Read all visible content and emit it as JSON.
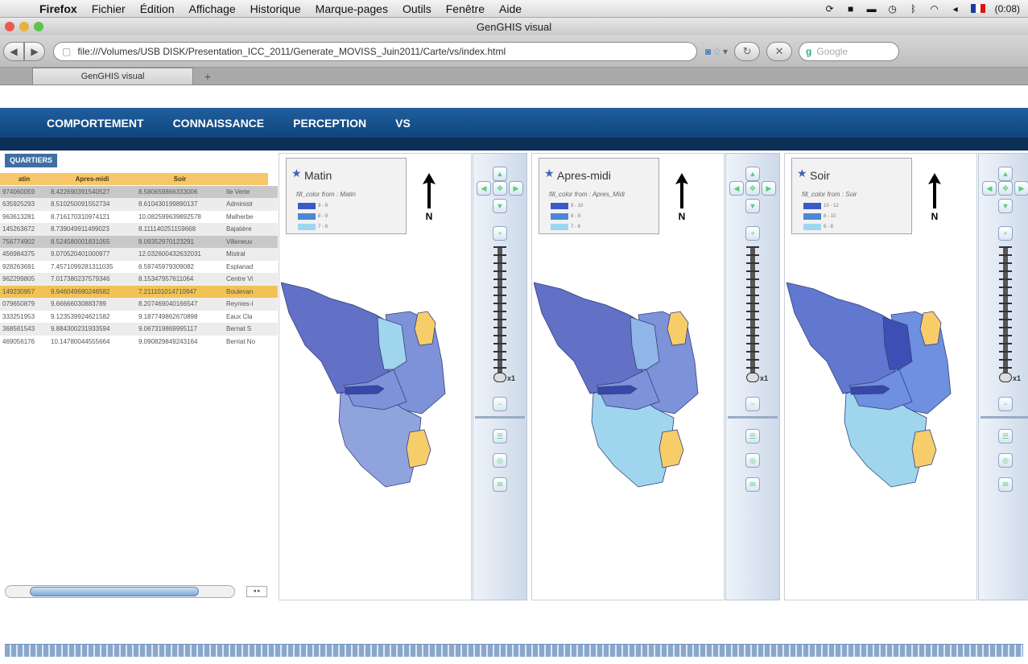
{
  "menubar": {
    "app": "Firefox",
    "items": [
      "Fichier",
      "Édition",
      "Affichage",
      "Historique",
      "Marque-pages",
      "Outils",
      "Fenêtre",
      "Aide"
    ],
    "clock": "(0:08)"
  },
  "window": {
    "title": "GenGHIS visual"
  },
  "toolbar": {
    "url": "file:///Volumes/USB DISK/Presentation_ICC_2011/Generate_MOVISS_Juin2011/Carte/vs/index.html",
    "search_placeholder": "Google"
  },
  "tabs": [
    {
      "label": "GenGHIS visual"
    }
  ],
  "new_tab": "+",
  "app_nav": [
    "COMPORTEMENT",
    "CONNAISSANCE",
    "PERCEPTION",
    "VS"
  ],
  "quartiers": {
    "tab": "QUARTIERS",
    "headers": [
      "atin",
      "Apres-midi",
      "Soir",
      ""
    ],
    "rows": [
      [
        "974060059",
        "8.42269039154052​7",
        "8.5806598663330​06",
        "Ile Verte"
      ],
      [
        "635925293",
        "8.510250091552734",
        "8.610430199890137",
        "Administr"
      ],
      [
        "963613281",
        "8.716170310974121",
        "10.082599639892578",
        "Malherbe"
      ],
      [
        "145263672",
        "8.739049911499023",
        "8.11114025115966​8",
        "Bajatière"
      ],
      [
        "756774902",
        "8.524580001831055",
        "8.09352970123291",
        "Villeneuv"
      ],
      [
        "456984375",
        "9.070520401000977",
        "12.03260043263203​1",
        "Mistral"
      ],
      [
        "928263691",
        "7.4571099281311035",
        "6.59745979309082",
        "Esplanad"
      ],
      [
        "962299805",
        "7.017380237579346",
        "8.15347957611064",
        "Centre Vi"
      ],
      [
        "149230957",
        "9.946049690246582",
        "7.21110101​4710947",
        "Boulevan"
      ],
      [
        "079650879",
        "9.66666030883789",
        "8.20746904016​6547",
        "Reynies-l"
      ],
      [
        "333251953",
        "9.123539924621582",
        "9.187749862670898",
        "Eaux Cla"
      ],
      [
        "368581543",
        "9.884300231933594",
        "9.067319869995117",
        "Bernat S"
      ],
      [
        "469056176",
        "10.14780044555664",
        "9.090829849243164",
        "Berriat No"
      ]
    ]
  },
  "scroll_arrows": "◂ ▸",
  "maps": [
    {
      "title": "Matin",
      "fill": "fill_color from : Matin",
      "legend": [
        {
          "label": "9 - 9",
          "color": "#3b5bc4"
        },
        {
          "label": "8 - 9",
          "color": "#4e87d4"
        },
        {
          "label": "7 - 8",
          "color": "#9fd6ee"
        }
      ],
      "north": "N",
      "zoom": "x1"
    },
    {
      "title": "Apres-midi",
      "fill": "fill_color from : Apres_Midi",
      "legend": [
        {
          "label": "9 - 10",
          "color": "#3b5bc4"
        },
        {
          "label": "8 - 9",
          "color": "#4e87d4"
        },
        {
          "label": "7 - 8",
          "color": "#9fd6ee"
        }
      ],
      "north": "N",
      "zoom": "x1"
    },
    {
      "title": "Soir",
      "fill": "fill_color from : Soir",
      "legend": [
        {
          "label": "10 - 12",
          "color": "#3b5bc4"
        },
        {
          "label": "8 - 10",
          "color": "#4e87d4"
        },
        {
          "label": "6 - 8",
          "color": "#9fd6ee"
        }
      ],
      "north": "N",
      "zoom": "x1"
    }
  ],
  "colors": {
    "app_nav": "#134b86",
    "table_header": "#f7c66a",
    "selected_row": "#f2c254",
    "map_dark": "#6270c6",
    "map_light": "#9fd6ee",
    "map_orange": "#f7cd6a"
  }
}
